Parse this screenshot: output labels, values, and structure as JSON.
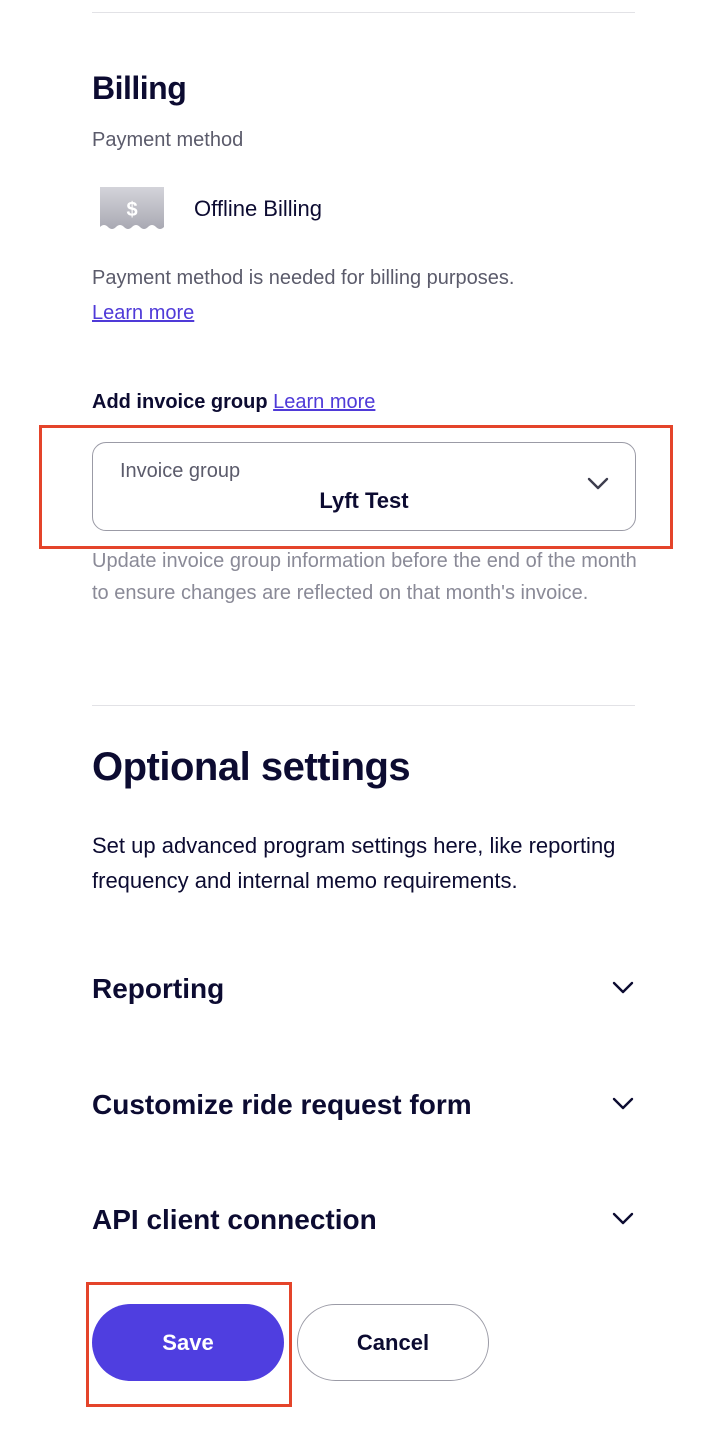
{
  "billing": {
    "title": "Billing",
    "payment_method_label": "Payment method",
    "payment_method_icon": "dollar-bill-icon",
    "payment_method_value": "Offline Billing",
    "help_text": "Payment method is needed for billing purposes.",
    "learn_more": "Learn more"
  },
  "invoice_group": {
    "add_label": "Add invoice group",
    "learn_more": "Learn more",
    "select_label": "Invoice group",
    "select_value": "Lyft Test",
    "help_text": "Update invoice group information before the end of the month to ensure changes are reflected on that month's invoice."
  },
  "optional_settings": {
    "title": "Optional settings",
    "description": "Set up advanced program settings here, like reporting frequency and internal memo requirements.",
    "sections": [
      {
        "title": "Reporting"
      },
      {
        "title": "Customize ride request form"
      },
      {
        "title": "API client connection"
      }
    ]
  },
  "actions": {
    "save": "Save",
    "cancel": "Cancel"
  },
  "colors": {
    "primary": "#4f3ee0",
    "link": "#4f3ad8",
    "highlight": "#e4442a",
    "text": "#0c0b31"
  }
}
